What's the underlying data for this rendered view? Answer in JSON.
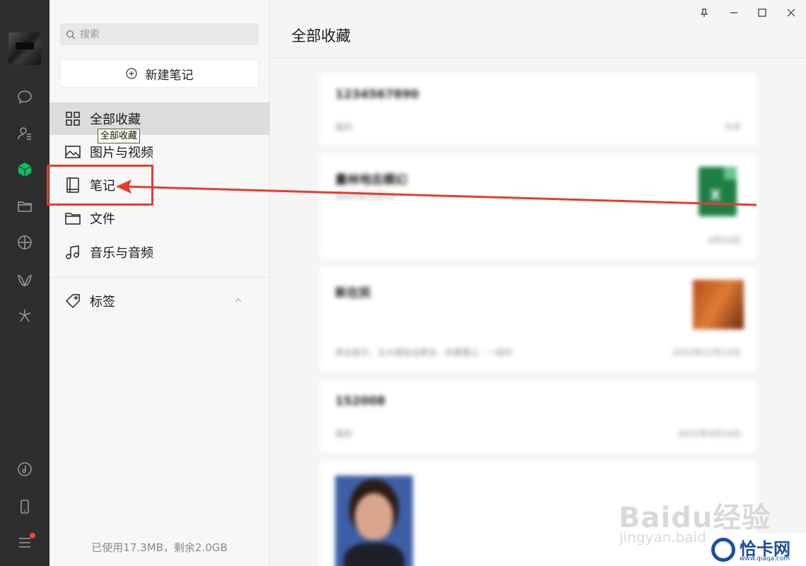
{
  "window": {
    "controls": [
      "pin-icon",
      "minimize-icon",
      "maximize-icon",
      "close-icon"
    ]
  },
  "rail": {
    "icons": [
      "chat-icon",
      "contacts-icon",
      "favorites-cube-icon",
      "folder-icon",
      "moments-icon",
      "channels-icon",
      "search-spark-icon",
      "music-icon",
      "phone-icon",
      "menu-icon"
    ],
    "active": "favorites-cube-icon",
    "accent_color": "#07c160"
  },
  "sidebar": {
    "search_placeholder": "搜索",
    "new_note_label": "新建笔记",
    "items": [
      {
        "label": "全部收藏",
        "icon": "grid-icon"
      },
      {
        "label": "图片与视频",
        "icon": "image-icon"
      },
      {
        "label": "笔记",
        "icon": "notebook-icon"
      },
      {
        "label": "文件",
        "icon": "folder-icon"
      },
      {
        "label": "音乐与音频",
        "icon": "music-note-icon"
      }
    ],
    "tooltip": "全部收藏",
    "tags_label": "标签",
    "storage_text": "已使用17.3MB，剩余2.0GB"
  },
  "main": {
    "title": "全部收藏",
    "cards": [
      {
        "title": "1234567890",
        "source": "我的",
        "date": "今天"
      },
      {
        "title": "量林地志模幻",
        "source": "2021年11月11",
        "date": "4月14日"
      },
      {
        "title": "新在民",
        "source": "来自音乐：五大模拟运费支 · 你要看认 · 一段时",
        "date": "2022年12月12日"
      },
      {
        "title": "152008",
        "source": "我的",
        "date": "2022年4月14日"
      },
      {
        "title": "",
        "source": "",
        "date": ""
      }
    ]
  },
  "annotation": {
    "color": "#e43d2f"
  },
  "watermark": {
    "baidu": "Baidu经验",
    "baidu_sub": "jingyan.baidu",
    "site_name": "恰卡网",
    "site_url": "www.qiaqa.com"
  }
}
